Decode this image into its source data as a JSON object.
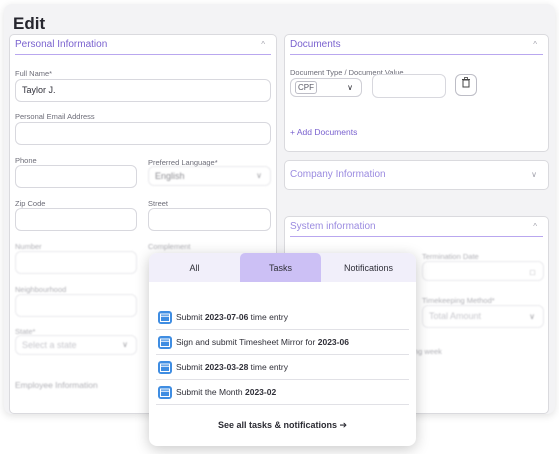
{
  "page": {
    "title": "Edit"
  },
  "personal": {
    "header": "Personal Information",
    "full_name_label": "Full Name*",
    "full_name_value": "Taylor J.",
    "email_label": "Personal Email Address",
    "phone_label": "Phone",
    "language_label": "Preferred Language*",
    "language_value": "English",
    "zip_label": "Zip Code",
    "street_label": "Street",
    "number_label": "Number",
    "complement_label": "Complement",
    "neighbourhood_label": "Neighbourhood",
    "state_label": "State*",
    "state_placeholder": "Select a state",
    "employee_info_label": "Employee Information"
  },
  "documents": {
    "header": "Documents",
    "type_label": "Document Type / Document Value",
    "type_value": "CPF",
    "add_label": "+ Add Documents"
  },
  "company": {
    "header": "Company Information"
  },
  "system": {
    "header": "System information",
    "termination_label": "Termination Date",
    "timekeeping_label": "Timekeeping Method*",
    "timekeeping_value": "Total Amount",
    "week_text": "ng week"
  },
  "popup": {
    "tabs": [
      {
        "label": "All",
        "active": false
      },
      {
        "label": "Tasks",
        "active": true
      },
      {
        "label": "Notifications",
        "active": false
      }
    ],
    "tasks": [
      {
        "prefix": "Submit ",
        "bold": "2023-07-06",
        "suffix": " time entry"
      },
      {
        "prefix": "Sign and submit Timesheet Mirror for ",
        "bold": "2023-06",
        "suffix": ""
      },
      {
        "prefix": "Submit ",
        "bold": "2023-03-28",
        "suffix": " time entry"
      },
      {
        "prefix": "Submit the Month ",
        "bold": "2023-02",
        "suffix": ""
      }
    ],
    "see_all": "See all tasks & notifications ➔"
  },
  "colors": {
    "accent": "#7a62cf",
    "tab_active": "#ccc0f5",
    "calendar_icon": "#3f8de2"
  }
}
